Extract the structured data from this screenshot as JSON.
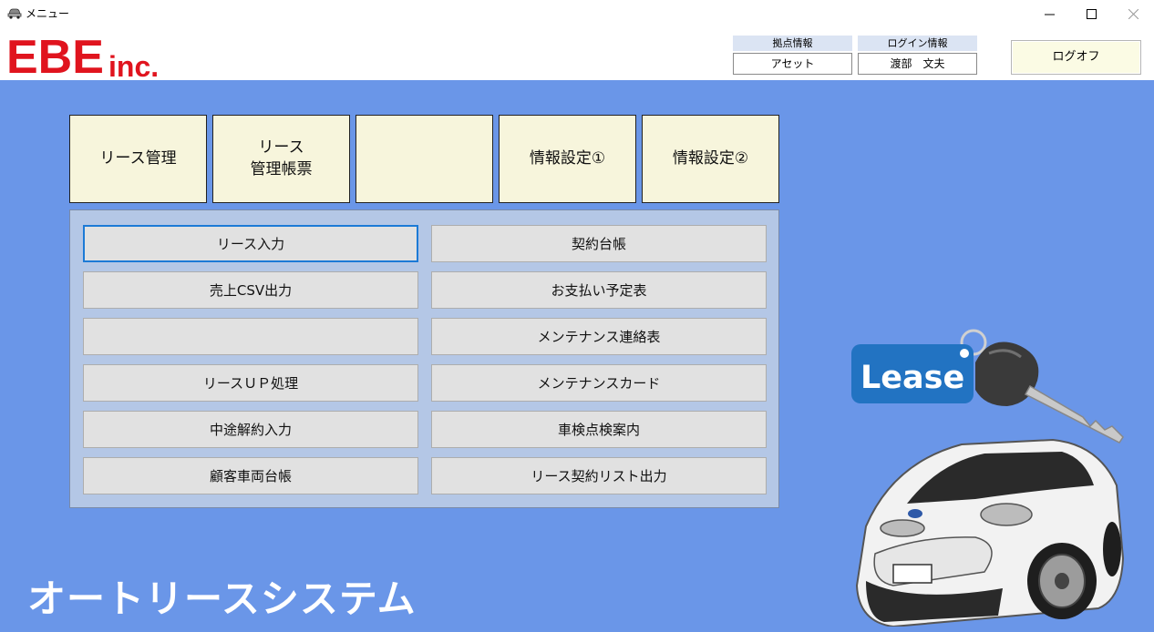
{
  "window": {
    "title": "メニュー",
    "minimize": "—",
    "maximize": "☐",
    "close": "✕"
  },
  "header": {
    "logo_main": "EBE",
    "logo_sub": "inc.",
    "base_label": "拠点情報",
    "base_value": "アセット",
    "login_label": "ログイン情報",
    "login_value": "渡部　文夫",
    "logoff_label": "ログオフ"
  },
  "tabs": [
    {
      "label": "リース管理"
    },
    {
      "label": "リース\n管理帳票"
    },
    {
      "label": ""
    },
    {
      "label": "情報設定①"
    },
    {
      "label": "情報設定②"
    }
  ],
  "menu_left": [
    {
      "label": "リース入力"
    },
    {
      "label": "売上CSV出力"
    },
    {
      "label": ""
    },
    {
      "label": "リースＵＰ処理"
    },
    {
      "label": "中途解約入力"
    },
    {
      "label": "顧客車両台帳"
    }
  ],
  "menu_right": [
    {
      "label": "契約台帳"
    },
    {
      "label": "お支払い予定表"
    },
    {
      "label": "メンテナンス連絡表"
    },
    {
      "label": "メンテナンスカード"
    },
    {
      "label": "車検点検案内"
    },
    {
      "label": "リース契約リスト出力"
    }
  ],
  "brand_title": "オートリースシステム",
  "illustration": {
    "tag_text": "Lease"
  },
  "colors": {
    "main_bg": "#6a96e8",
    "logo_red": "#e0141e",
    "tab_bg": "#f7f5dc",
    "panel_bg": "#b4c7e6",
    "button_bg": "#e1e1e1",
    "focus_border": "#1c7ad6",
    "tag_blue": "#2273c2"
  }
}
